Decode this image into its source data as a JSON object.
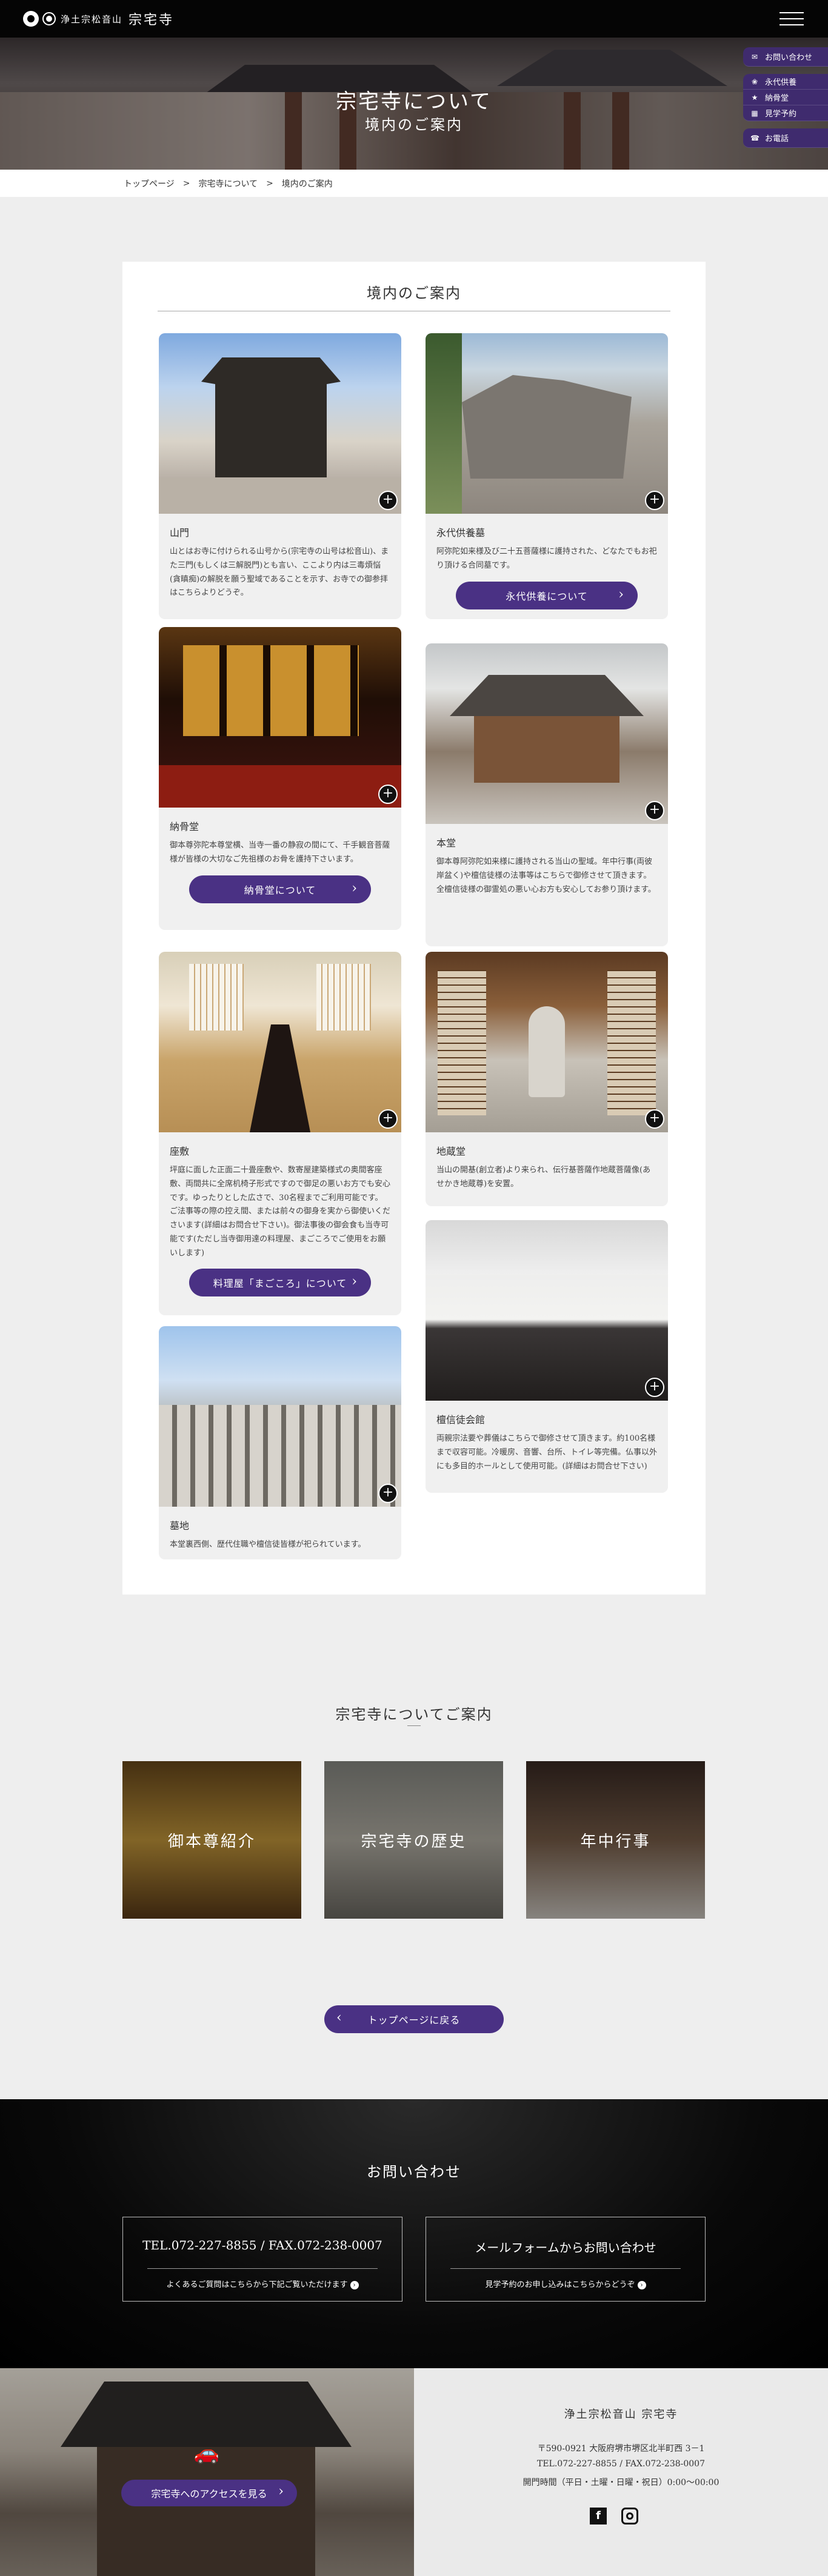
{
  "header": {
    "logo_sub": "浄土宗松音山",
    "logo_main": "宗宅寺",
    "menu_icon": "hamburger-icon"
  },
  "hero": {
    "title": "宗宅寺について",
    "subtitle": "境内のご案内"
  },
  "side_menu": [
    {
      "label": "お問い合わせ",
      "icon": "mail-icon"
    },
    {
      "label": "永代供養",
      "icon": "lotus-icon"
    },
    {
      "label": "納骨堂",
      "icon": "star-icon"
    },
    {
      "label": "見学予約",
      "icon": "calendar-icon"
    },
    {
      "label": "お電話",
      "icon": "phone-icon"
    }
  ],
  "breadcrumb": {
    "items": [
      "トップページ",
      "宗宅寺について",
      "境内のご案内"
    ],
    "separator": ">"
  },
  "section": {
    "title": "境内のご案内"
  },
  "cards": [
    {
      "title": "山門",
      "text": "山とはお寺に付けられる山号から(宗宅寺の山号は松音山)、また三門(もしくは三解脱門)とも言い、ここより内は三毒煩悩(貪瞋痴)の解脱を願う聖域であることを示す、お寺での御参拝はこちらよりどうぞ。"
    },
    {
      "title": "永代供養墓",
      "text": "阿弥陀如来様及び二十五菩薩様に護持された、どなたでもお祀り頂ける合同墓です。",
      "button": "永代供養について"
    },
    {
      "title": "納骨堂",
      "text": "御本尊弥陀本尊堂横、当寺一番の静寂の間にて、千手観音菩薩様が皆様の大切なご先祖様のお骨を護持下さいます。",
      "button": "納骨堂について"
    },
    {
      "title": "本堂",
      "text": "御本尊阿弥陀如来様に護持される当山の聖域。年中行事(両彼岸盆く)や檀信徒様の法事等はこちらで御修させて頂きます。全檀信徒様の御霊処の悪い心お方も安心してお参り頂けます。"
    },
    {
      "title": "座敷",
      "text": "坪庭に面した正面二十畳座敷や、数寄屋建築様式の奥間客座敷、両間共に全席机椅子形式ですので御足の悪いお方でも安心です。ゆったりとした広さで、30名程までご利用可能です。ご法事等の際の控え間、または前々の御身を実から御使いくださいます(詳細はお問合せ下さい)。御法事後の御会食も当寺可能です(ただし当寺御用達の料理屋、まごころでご使用をお願いします)",
      "button": "料理屋「まごころ」について"
    },
    {
      "title": "地蔵堂",
      "text": "当山の開基(創立者)より来られ、伝行基菩薩作地蔵菩薩像(あせかき地蔵尊)を安置。"
    },
    {
      "title": "檀信徒会館",
      "text": "両親宗法要や葬儀はこちらで御修させて頂きます。約100名様まで収容可能。冷暖房、音響、台所、トイレ等完備。仏事以外にも多目的ホールとして使用可能。(詳細はお問合せ下さい)"
    },
    {
      "title": "墓地",
      "text": "本堂裏西側、歴代住職や檀信徒皆様が祀られています。"
    }
  ],
  "intro": {
    "title": "宗宅寺についてご案内",
    "tiles": [
      "御本尊紹介",
      "宗宅寺の歴史",
      "年中行事"
    ]
  },
  "back_button": "トップページに戻る",
  "contact": {
    "title": "お問い合わせ",
    "phone_box": {
      "main": "TEL.072-227-8855 / FAX.072-238-0007",
      "sub": "よくあるご質問はこちらから下記ご覧いただけます"
    },
    "mail_box": {
      "main": "メールフォームからお問い合わせ",
      "sub": "見学予約のお申し込みはこちらからどうぞ"
    }
  },
  "footer": {
    "access_button": "宗宅寺へのアクセスを見る",
    "car_icon": "car-icon",
    "name": "浄土宗松音山 宗宅寺",
    "address": "〒590-0921 大阪府堺市堺区北半町西 3－1",
    "tel": "TEL.072-227-8855 / FAX.072-238-0007",
    "hours": "開門時間（平日・土曜・日曜・祝日）0:00〜00:00",
    "sns": [
      "facebook-icon",
      "instagram-icon"
    ]
  },
  "colors": {
    "accent": "#4a3184",
    "dark": "#050505",
    "card_bg": "#f0f0f0"
  }
}
